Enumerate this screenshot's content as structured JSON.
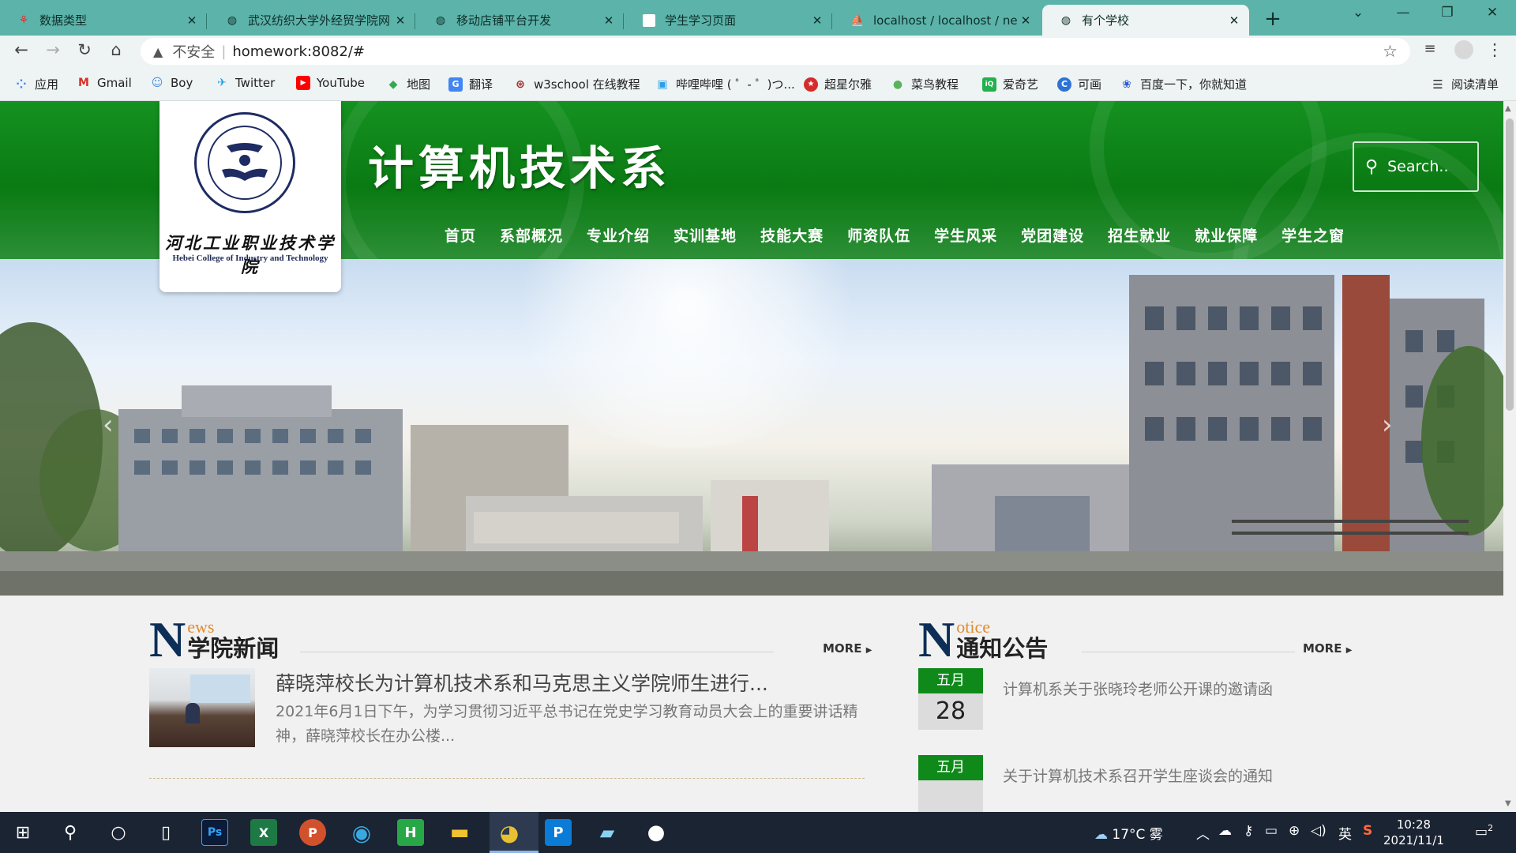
{
  "browser": {
    "tabs": [
      {
        "title": "数据类型",
        "icon": "tab-favicon-red"
      },
      {
        "title": "武汉纺织大学外经贸学院网",
        "icon": "globe-icon"
      },
      {
        "title": "移动店铺平台开发",
        "icon": "globe-icon"
      },
      {
        "title": "学生学习页面",
        "icon": "blank-page-icon"
      },
      {
        "title": "localhost / localhost / ne",
        "icon": "phpmyadmin-icon"
      },
      {
        "title": "有个学校",
        "icon": "globe-icon",
        "active": true
      }
    ],
    "address": {
      "security": "不安全",
      "url": "homework:8082/#"
    },
    "bookmarks": [
      {
        "label": "应用",
        "icon": "apps-icon",
        "color": "#4285f4"
      },
      {
        "label": "Gmail",
        "icon": "gmail-icon",
        "color": "#d93025"
      },
      {
        "label": "Boy",
        "icon": "boy-icon",
        "color": "#4a8de0"
      },
      {
        "label": "Twitter",
        "icon": "twitter-icon",
        "color": "#1da1f2"
      },
      {
        "label": "YouTube",
        "icon": "youtube-icon",
        "color": "#ff0000"
      },
      {
        "label": "地图",
        "icon": "maps-icon",
        "color": "#34a853"
      },
      {
        "label": "翻译",
        "icon": "translate-icon",
        "color": "#4285f4"
      },
      {
        "label": "w3school 在线教程",
        "icon": "w3school-icon",
        "color": "#a12a2a"
      },
      {
        "label": "哔哩哔哩 ( ゜- ゜)つ...",
        "icon": "bilibili-icon",
        "color": "#2f9ee6"
      },
      {
        "label": "超星尔雅",
        "icon": "chaoxing-icon",
        "color": "#d62b2b"
      },
      {
        "label": "菜鸟教程",
        "icon": "runoob-icon",
        "color": "#5ab35a"
      },
      {
        "label": "爱奇艺",
        "icon": "iqiyi-icon",
        "color": "#22b14c"
      },
      {
        "label": "可画",
        "icon": "canva-icon",
        "color": "#2d73d6"
      },
      {
        "label": "百度一下，你就知道",
        "icon": "baidu-icon",
        "color": "#2a5bd7"
      }
    ],
    "reading_list": "阅读清单"
  },
  "page": {
    "logo": {
      "cn": "河北工业职业技术学院",
      "en": "Hebei College of Industry and Technology"
    },
    "dept_title": "计算机技术系",
    "search_placeholder": "Search..",
    "nav": [
      "首页",
      "系部概况",
      "专业介绍",
      "实训基地",
      "技能大赛",
      "师资队伍",
      "学生风采",
      "党团建设",
      "招生就业",
      "就业保障",
      "学生之窗"
    ],
    "news": {
      "big_letter": "N",
      "small": "ews",
      "heading": "学院新闻",
      "more": "MORE",
      "items": [
        {
          "title": "薛晓萍校长为计算机技术系和马克思主义学院师生进行...",
          "desc": "2021年6月1日下午，为学习贯彻习近平总书记在党史学习教育动员大会上的重要讲话精神，薛晓萍校长在办公楼..."
        }
      ]
    },
    "notice": {
      "big_letter": "N",
      "small": "otice",
      "heading": "通知公告",
      "more": "MORE",
      "items": [
        {
          "month": "五月",
          "day": "28",
          "title": "计算机系关于张晓玲老师公开课的邀请函"
        },
        {
          "month": "五月",
          "day": "",
          "title": "关于计算机技术系召开学生座谈会的通知"
        }
      ]
    }
  },
  "taskbar": {
    "weather": "17°C 雾",
    "ime": "英",
    "time": "10:28",
    "date": "2021/11/1",
    "notifications": "2",
    "apps": [
      "windows-start-icon",
      "search-icon",
      "cortana-icon",
      "task-view-icon",
      "photoshop-icon",
      "excel-icon",
      "powerpoint-icon",
      "edge-icon",
      "hbuilder-icon",
      "file-explorer-icon",
      "chrome-icon",
      "publisher-icon",
      "notepad-icon",
      "qq-icon"
    ]
  }
}
